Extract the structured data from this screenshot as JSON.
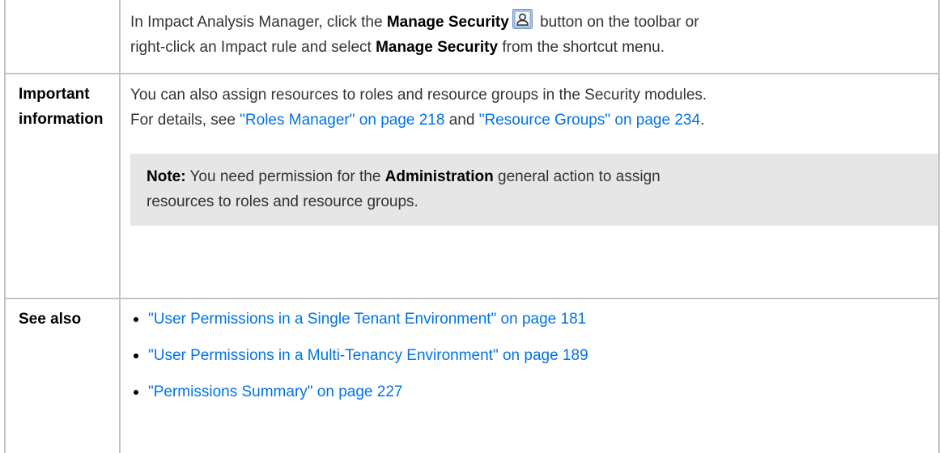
{
  "row_intro": {
    "line1_prefix": "In Impact Analysis Manager, click the ",
    "line1_button": "Manage Security",
    "line1_suffix": " button on the toolbar or",
    "line2_prefix": "right-click an Impact rule and select ",
    "line2_menu": "Manage Security",
    "line2_suffix": " from the shortcut menu.",
    "icon": "manage-security-icon"
  },
  "row_important": {
    "label_line1": "Important",
    "label_line2": "information",
    "text1": "You can also assign resources to roles and resource groups in the Security modules.",
    "text2_prefix": "For details, see ",
    "link1": "\"Roles Manager\" on page 218",
    "text2_mid": " and ",
    "link2": "\"Resource Groups\" on page 234",
    "text2_suffix": ".",
    "note": {
      "label": "Note:",
      "text_prefix": " You need permission for the ",
      "action": "Administration",
      "text_suffix": " general action to assign",
      "line2": "resources to roles and resource groups."
    }
  },
  "row_see_also": {
    "label": "See also",
    "links": [
      "\"User Permissions in a Single Tenant Environment\" on page 181",
      "\"User Permissions in a Multi-Tenancy Environment\" on page 189",
      "\"Permissions Summary\" on page 227"
    ]
  },
  "colors": {
    "link": "#0073e7",
    "border": "#c4c4c4",
    "note_bg": "#e6e6e6"
  }
}
